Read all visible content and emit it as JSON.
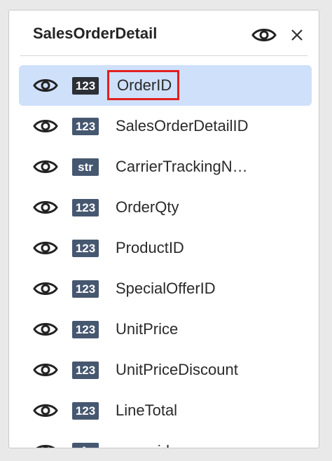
{
  "panel": {
    "title": "SalesOrderDetail",
    "header_icons": [
      "eye-icon",
      "close-icon"
    ]
  },
  "columns": [
    {
      "label": "OrderID",
      "type": "123",
      "selected": true
    },
    {
      "label": "SalesOrderDetailID",
      "type": "123",
      "selected": false
    },
    {
      "label": "CarrierTrackingN…",
      "type": "str",
      "selected": false
    },
    {
      "label": "OrderQty",
      "type": "123",
      "selected": false
    },
    {
      "label": "ProductID",
      "type": "123",
      "selected": false
    },
    {
      "label": "SpecialOfferID",
      "type": "123",
      "selected": false
    },
    {
      "label": "UnitPrice",
      "type": "123",
      "selected": false
    },
    {
      "label": "UnitPriceDiscount",
      "type": "123",
      "selected": false
    },
    {
      "label": "LineTotal",
      "type": "123",
      "selected": false
    },
    {
      "label": "rowguid",
      "type": "λ",
      "selected": false
    }
  ],
  "colors": {
    "selected_row_bg": "#cfe0fb",
    "highlight_border": "#e0201f",
    "badge_bg": "#465770",
    "badge_selected_bg": "#2b2f36"
  }
}
